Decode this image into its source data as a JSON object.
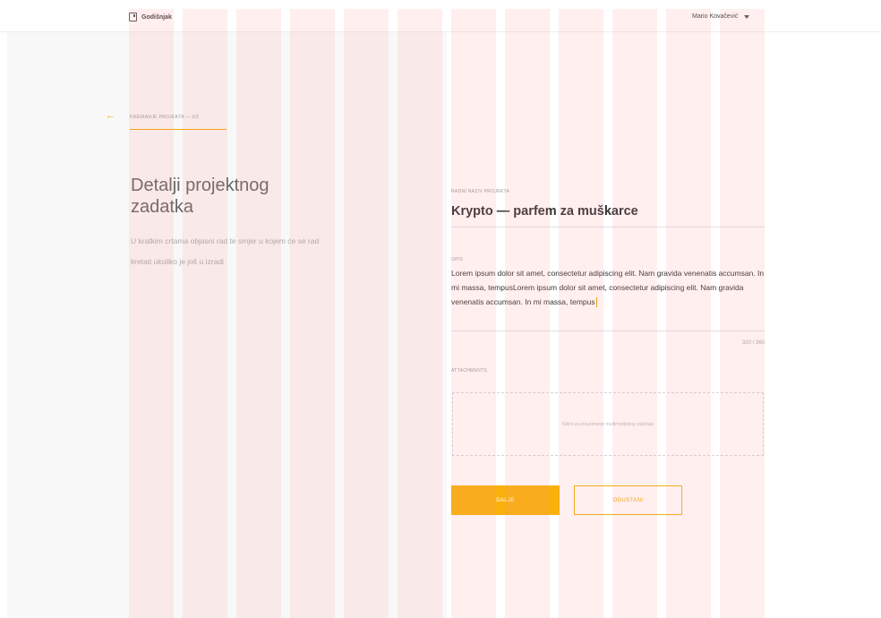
{
  "app": {
    "name": "Godišnjak",
    "user": "Mario Kovačević"
  },
  "wizard": {
    "step_label": "KREIRANJE PROJEKTA — 3/3",
    "title": "Detalji projektnog zadatka",
    "description": "U kratkim crtama objasni rad te smjer u kojem će se rad kretati ukoliko je još u izradi"
  },
  "form": {
    "project_name_label": "RADNI NAZIV PROJEKTA",
    "project_name": "Krypto — parfem za muškarce",
    "description_label": "OPIS",
    "description_value": "Lorem ipsum dolor sit amet, consectetur adipiscing elit. Nam gravida venenatis  accumsan. In mi massa, tempusLorem ipsum dolor sit amet, consectetur adipiscing elit. Nam gravida venenatis  accumsan. In mi massa, tempus",
    "char_count": "320 / 360",
    "attachments_label": "ATTACHMENTS",
    "dropzone_text": "Klikni za preuzimanje multimedijskog sadržaja",
    "next_button": "DALJE",
    "cancel_button": "ODUSTANI"
  },
  "colors": {
    "accent": "#f9b10c",
    "grid_overlay": "#ffdcdc"
  },
  "icons": {
    "back": "arrow-left-icon",
    "logo": "calendar-icon",
    "user_menu": "caret-down-icon"
  }
}
